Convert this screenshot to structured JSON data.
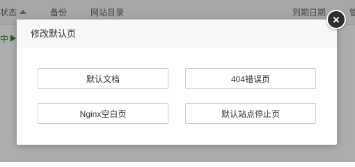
{
  "background": {
    "columns": {
      "status": "状态",
      "backup": "备份",
      "root_dir": "网站目录",
      "expire": "到期日期",
      "edge": "管"
    },
    "row_status": "中"
  },
  "modal": {
    "title": "修改默认页",
    "close_icon": "×",
    "buttons": {
      "default_doc": "默认文档",
      "page_404": "404错误页",
      "nginx_blank": "Nginx空白页",
      "site_stopped": "默认站点停止页"
    }
  }
}
